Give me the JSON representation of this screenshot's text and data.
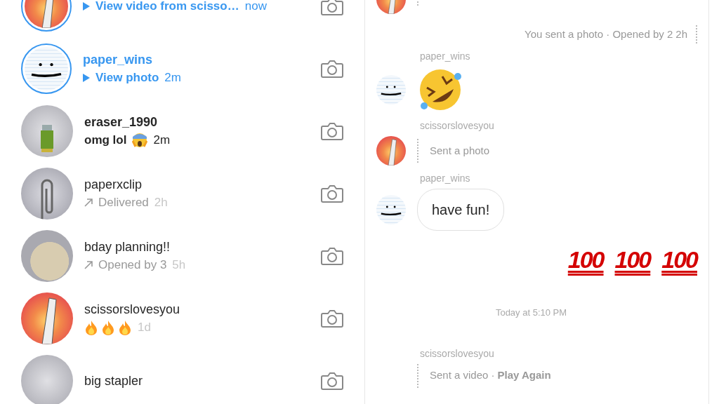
{
  "threads": [
    {
      "kind": "unopened_media",
      "avatar": {
        "kind": "scissors"
      },
      "preview": "View video from scisso…",
      "time": "now"
    },
    {
      "name": "paper_wins",
      "kind": "unopened_media",
      "avatar": {
        "kind": "paper"
      },
      "preview": "View photo",
      "time": "2m"
    },
    {
      "name": "eraser_1990",
      "kind": "unread_text",
      "avatar": {
        "kind": "eraser"
      },
      "preview": "omg lol",
      "time": "2m"
    },
    {
      "name": "paperxclip",
      "kind": "sent",
      "avatar": {
        "kind": "clip"
      },
      "preview": "Delivered",
      "time": "2h"
    },
    {
      "name": "bday planning!!",
      "kind": "sent",
      "avatar": {
        "kind": "group"
      },
      "preview": "Opened by 3",
      "time": "5h"
    },
    {
      "name": "scissorslovesyou",
      "kind": "reaction",
      "avatar": {
        "kind": "scissors"
      },
      "time": "1d"
    },
    {
      "name": "big stapler",
      "kind": "cut",
      "avatar": {
        "kind": "stapler"
      }
    }
  ],
  "messages": [
    {
      "kind": "cut",
      "avatar": {
        "kind": "scissors"
      }
    },
    {
      "kind": "own_status",
      "text": "You sent a photo · Opened by 2",
      "time": "2h"
    },
    {
      "kind": "big_emoji",
      "sender": "paper_wins",
      "avatar": {
        "kind": "paper"
      }
    },
    {
      "kind": "media",
      "sender": "scissorslovesyou",
      "avatar": {
        "kind": "scissors"
      },
      "text": "Sent a photo"
    },
    {
      "kind": "bubble",
      "sender": "paper_wins",
      "avatar": {
        "kind": "paper"
      },
      "text": "have fun!"
    },
    {
      "kind": "own_hundreds",
      "items": [
        "100",
        "100",
        "100"
      ]
    },
    {
      "kind": "date",
      "text": "Today at 5:10 PM"
    },
    {
      "kind": "media",
      "sender": "scissorslovesyou",
      "text": "Sent a video · ",
      "action": "Play Again"
    }
  ]
}
